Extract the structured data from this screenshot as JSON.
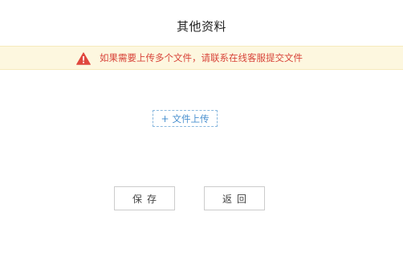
{
  "page": {
    "title": "其他资料"
  },
  "notice": {
    "icon": "warning-icon",
    "text": "如果需要上传多个文件，请联系在线客服提交文件",
    "color": "#d8443a",
    "background": "#fdf7df"
  },
  "upload": {
    "plus": "+",
    "label": "文件上传",
    "color": "#4a90cf"
  },
  "actions": {
    "save_label": "保存",
    "back_label": "返回"
  }
}
